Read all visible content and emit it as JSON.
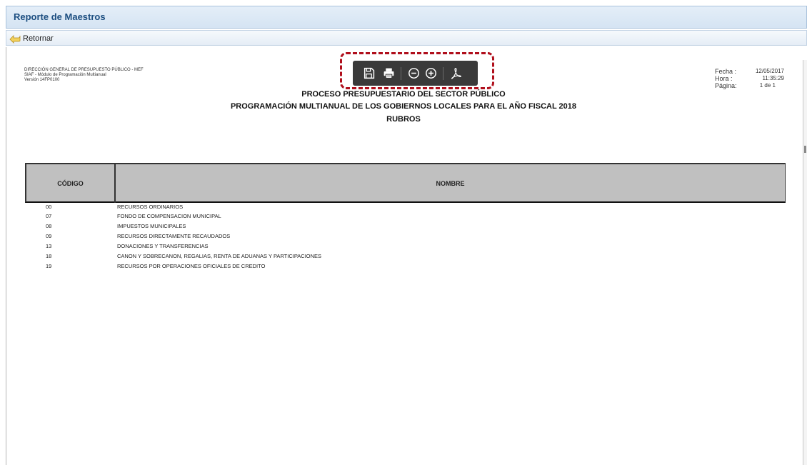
{
  "window": {
    "title": "Reporte de Maestros"
  },
  "toolbar": {
    "back_label": "Retornar",
    "back_icon": "return-arrow-icon"
  },
  "viewer_tools": [
    {
      "name": "save-button",
      "icon": "save-icon"
    },
    {
      "name": "print-button",
      "icon": "print-icon"
    },
    {
      "name": "zoom-out-button",
      "icon": "zoom-out-icon"
    },
    {
      "name": "zoom-in-button",
      "icon": "zoom-in-icon"
    },
    {
      "name": "export-pdf-button",
      "icon": "pdf-icon"
    }
  ],
  "highlight_color": "#b00f1c",
  "report": {
    "org_lines": [
      "DIRECCIÓN GENERAL DE PRESUPUESTO PÚBLICO - MEF",
      "SIAF - Módulo de Programación Multianual",
      "Versión 14FP0100"
    ],
    "meta": {
      "fecha_label": "Fecha :",
      "fecha": "12/05/2017",
      "hora_label": "Hora :",
      "hora": "11:35:29",
      "pagina_label": "Página:",
      "pagina": "1 de 1"
    },
    "title1": "PROCESO PRESUPUESTARIO DEL SECTOR PÚBLICO",
    "title2": "PROGRAMACIÓN MULTIANUAL DE LOS GOBIERNOS LOCALES PARA EL AÑO FISCAL 2018",
    "title3": "RUBROS",
    "columns": {
      "code": "CÓDIGO",
      "name": "NOMBRE"
    },
    "rows": [
      {
        "code": "00",
        "name": "RECURSOS ORDINARIOS"
      },
      {
        "code": "07",
        "name": "FONDO DE COMPENSACION MUNICIPAL"
      },
      {
        "code": "08",
        "name": "IMPUESTOS MUNICIPALES"
      },
      {
        "code": "09",
        "name": "RECURSOS DIRECTAMENTE RECAUDADOS"
      },
      {
        "code": "13",
        "name": "DONACIONES Y TRANSFERENCIAS"
      },
      {
        "code": "18",
        "name": "CANON Y SOBRECANON, REGALIAS, RENTA DE ADUANAS Y PARTICIPACIONES"
      },
      {
        "code": "19",
        "name": "RECURSOS POR OPERACIONES OFICIALES DE CREDITO"
      }
    ]
  }
}
